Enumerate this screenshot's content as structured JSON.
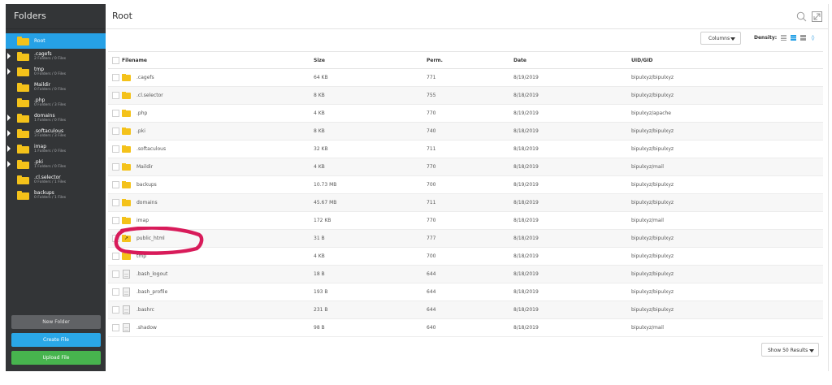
{
  "sidebar": {
    "title": "Folders",
    "tree": [
      {
        "name": "Root",
        "sub": "",
        "caret": false,
        "selected": true
      },
      {
        "name": ".cagefs",
        "sub": "2 Folders / 0 Files",
        "caret": true,
        "selected": false
      },
      {
        "name": "tmp",
        "sub": "0 Folders / 0 Files",
        "caret": true,
        "selected": false
      },
      {
        "name": "Maildir",
        "sub": "0 Folders / 0 Files",
        "caret": false,
        "selected": false
      },
      {
        "name": ".php",
        "sub": "0 Folders / 3 Files",
        "caret": false,
        "selected": false
      },
      {
        "name": "domains",
        "sub": "1 Folders / 0 Files",
        "caret": true,
        "selected": false
      },
      {
        "name": ".softaculous",
        "sub": "3 Folders / 3 Files",
        "caret": true,
        "selected": false
      },
      {
        "name": "imap",
        "sub": "1 Folders / 0 Files",
        "caret": true,
        "selected": false
      },
      {
        "name": ".pki",
        "sub": "1 Folders / 0 Files",
        "caret": true,
        "selected": false
      },
      {
        "name": ".cl.selector",
        "sub": "0 Folders / 1 Files",
        "caret": false,
        "selected": false
      },
      {
        "name": "backups",
        "sub": "0 Folders / 1 Files",
        "caret": false,
        "selected": false
      }
    ],
    "new_folder_label": "New Folder",
    "create_file_label": "Create File",
    "upload_file_label": "Upload File"
  },
  "main": {
    "title": "Root",
    "columns_label": "Columns",
    "density_label": "Density:",
    "show_results_label": "Show 50 Results"
  },
  "table": {
    "headers": [
      "Filename",
      "Size",
      "Perm.",
      "Date",
      "UID/GID"
    ],
    "rows": [
      {
        "icon": "folder",
        "name": ".cagefs",
        "size": "64 KB",
        "perm": "771",
        "date": "8/19/2019",
        "uid": "bipulxyz/bipulxyz"
      },
      {
        "icon": "folder",
        "name": ".cl.selector",
        "size": "8 KB",
        "perm": "755",
        "date": "8/18/2019",
        "uid": "bipulxyz/bipulxyz"
      },
      {
        "icon": "folder",
        "name": ".php",
        "size": "4 KB",
        "perm": "770",
        "date": "8/19/2019",
        "uid": "bipulxyz/apache"
      },
      {
        "icon": "folder",
        "name": ".pki",
        "size": "8 KB",
        "perm": "740",
        "date": "8/18/2019",
        "uid": "bipulxyz/bipulxyz"
      },
      {
        "icon": "folder",
        "name": ".softaculous",
        "size": "32 KB",
        "perm": "711",
        "date": "8/18/2019",
        "uid": "bipulxyz/bipulxyz"
      },
      {
        "icon": "folder",
        "name": "Maildir",
        "size": "4 KB",
        "perm": "770",
        "date": "8/18/2019",
        "uid": "bipulxyz/mail"
      },
      {
        "icon": "folder",
        "name": "backups",
        "size": "10.73 MB",
        "perm": "700",
        "date": "8/19/2019",
        "uid": "bipulxyz/bipulxyz"
      },
      {
        "icon": "folder",
        "name": "domains",
        "size": "45.67 MB",
        "perm": "711",
        "date": "8/18/2019",
        "uid": "bipulxyz/bipulxyz"
      },
      {
        "icon": "folder",
        "name": "imap",
        "size": "172 KB",
        "perm": "770",
        "date": "8/18/2019",
        "uid": "bipulxyz/mail"
      },
      {
        "icon": "symlink",
        "name": "public_html",
        "size": "31 B",
        "perm": "777",
        "date": "8/18/2019",
        "uid": "bipulxyz/bipulxyz"
      },
      {
        "icon": "folder",
        "name": "tmp",
        "size": "4 KB",
        "perm": "700",
        "date": "8/18/2019",
        "uid": "bipulxyz/bipulxyz"
      },
      {
        "icon": "file",
        "name": ".bash_logout",
        "size": "18 B",
        "perm": "644",
        "date": "8/18/2019",
        "uid": "bipulxyz/bipulxyz"
      },
      {
        "icon": "file",
        "name": ".bash_profile",
        "size": "193 B",
        "perm": "644",
        "date": "8/18/2019",
        "uid": "bipulxyz/bipulxyz"
      },
      {
        "icon": "file",
        "name": ".bashrc",
        "size": "231 B",
        "perm": "644",
        "date": "8/18/2019",
        "uid": "bipulxyz/bipulxyz"
      },
      {
        "icon": "file",
        "name": ".shadow",
        "size": "98 B",
        "perm": "640",
        "date": "8/18/2019",
        "uid": "bipulxyz/mail"
      }
    ]
  },
  "colors": {
    "sidebar_bg": "#333537",
    "selected": "#26a1e6",
    "folder": "#f4c21a",
    "create_button": "#2aa7e7",
    "upload_button": "#47b44e",
    "annotation": "#d81b5a"
  },
  "icons": {
    "search": "search-icon",
    "expand": "expand-icon",
    "folder": "folder-icon",
    "symlink": "symlink-folder-icon",
    "file": "file-icon"
  }
}
